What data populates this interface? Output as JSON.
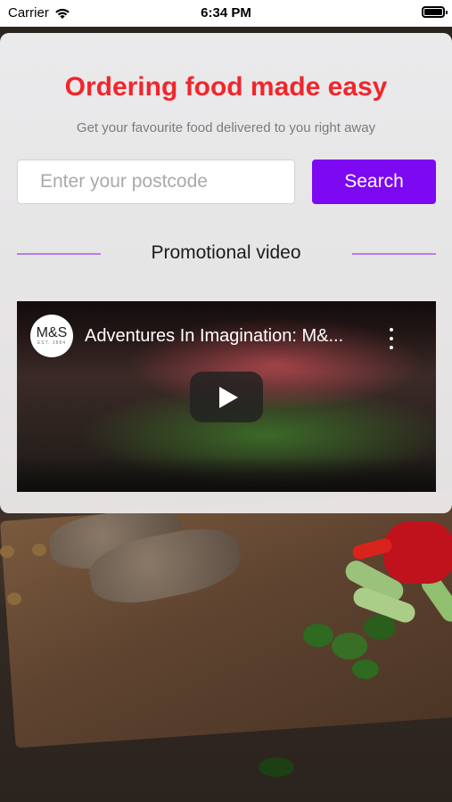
{
  "status_bar": {
    "carrier": "Carrier",
    "time": "6:34 PM"
  },
  "hero": {
    "headline": "Ordering food made easy",
    "subline": "Get your favourite food delivered to you right away"
  },
  "search": {
    "postcode_placeholder": "Enter your postcode",
    "postcode_value": "",
    "button_label": "Search"
  },
  "promo": {
    "section_title": "Promotional video"
  },
  "video": {
    "title": "Adventures In Imagination: M&...",
    "channel_logo_text": "M&S",
    "channel_logo_sub": "EST. 1884"
  },
  "colors": {
    "headline": "#f0262c",
    "accent": "#7d08f2",
    "divider": "#b47ee8"
  },
  "icons": [
    "wifi-icon",
    "battery-icon",
    "play-icon",
    "more-vertical-icon"
  ]
}
